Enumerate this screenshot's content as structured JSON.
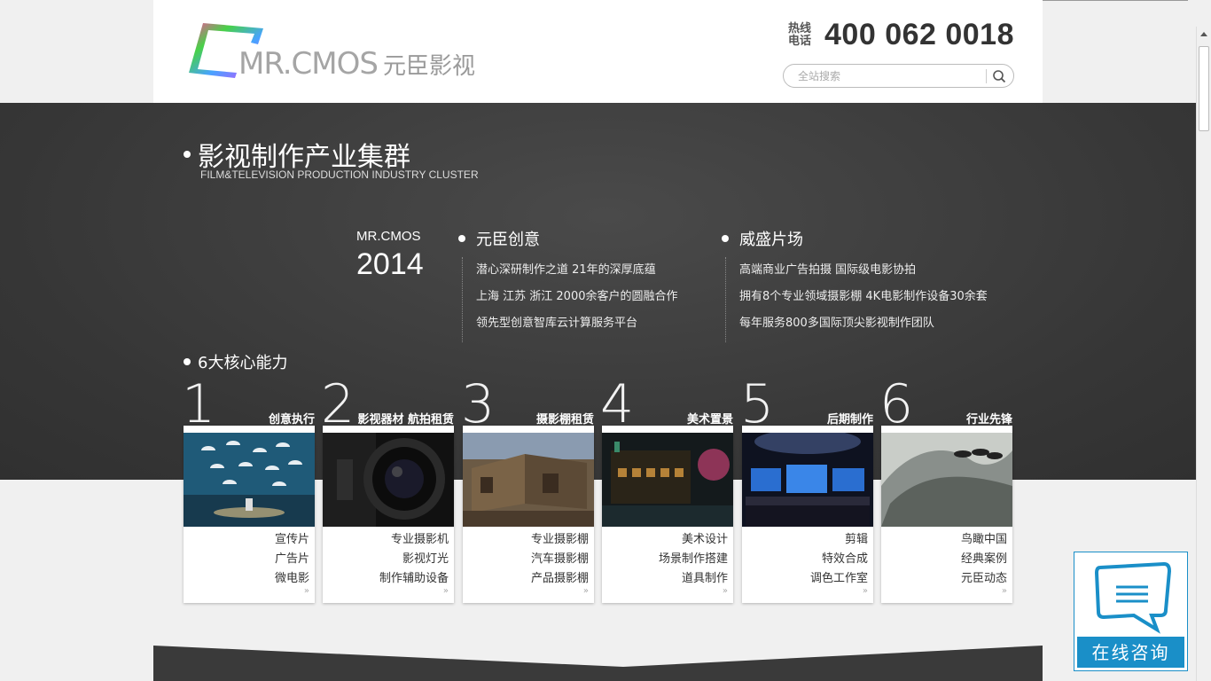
{
  "header": {
    "logo_text": "MR.CMOS",
    "logo_cn": "元臣影视",
    "hotline_label": "热线电话",
    "hotline_number": "400 062 0018",
    "search_placeholder": "全站搜索"
  },
  "intro": {
    "title": "影视制作产业集群",
    "subtitle": "FILM&TELEVISION PRODUCTION INDUSTRY CLUSTER",
    "brand_name": "MR.CMOS",
    "brand_year": "2014",
    "columns": [
      {
        "title": "元臣创意",
        "items": [
          "潜心深研制作之道 21年的深厚底蕴",
          "上海 江苏 浙江 2000余客户的圆融合作",
          "领先型创意智库云计算服务平台"
        ]
      },
      {
        "title": "威盛片场",
        "items": [
          "高端商业广告拍摄 国际级电影协拍",
          "拥有8个专业领域摄影棚 4K电影制作设备30余套",
          "每年服务800多国际顶尖影视制作团队"
        ]
      }
    ]
  },
  "core": {
    "title": "6大核心能力",
    "cards": [
      {
        "num": "1",
        "label": "创意执行",
        "links": [
          "宣传片",
          "广告片",
          "微电影"
        ],
        "more": "»"
      },
      {
        "num": "2",
        "label": "影视器材 航拍租赁",
        "links": [
          "专业摄影机",
          "影视灯光",
          "制作辅助设备"
        ],
        "more": "»"
      },
      {
        "num": "3",
        "label": "摄影棚租赁",
        "links": [
          "专业摄影棚",
          "汽车摄影棚",
          "产品摄影棚"
        ],
        "more": "»"
      },
      {
        "num": "4",
        "label": "美术置景",
        "links": [
          "美术设计",
          "场景制作搭建",
          "道具制作"
        ],
        "more": "»"
      },
      {
        "num": "5",
        "label": "后期制作",
        "links": [
          "剪辑",
          "特效合成",
          "调色工作室"
        ],
        "more": "»"
      },
      {
        "num": "6",
        "label": "行业先锋",
        "links": [
          "鸟瞰中国",
          "经典案例",
          "元臣动态"
        ],
        "more": "»"
      }
    ]
  },
  "chat": {
    "label": "在线咨询"
  },
  "colors": {
    "band": "#3a3a3a",
    "chat_blue": "#1a8fc8"
  }
}
